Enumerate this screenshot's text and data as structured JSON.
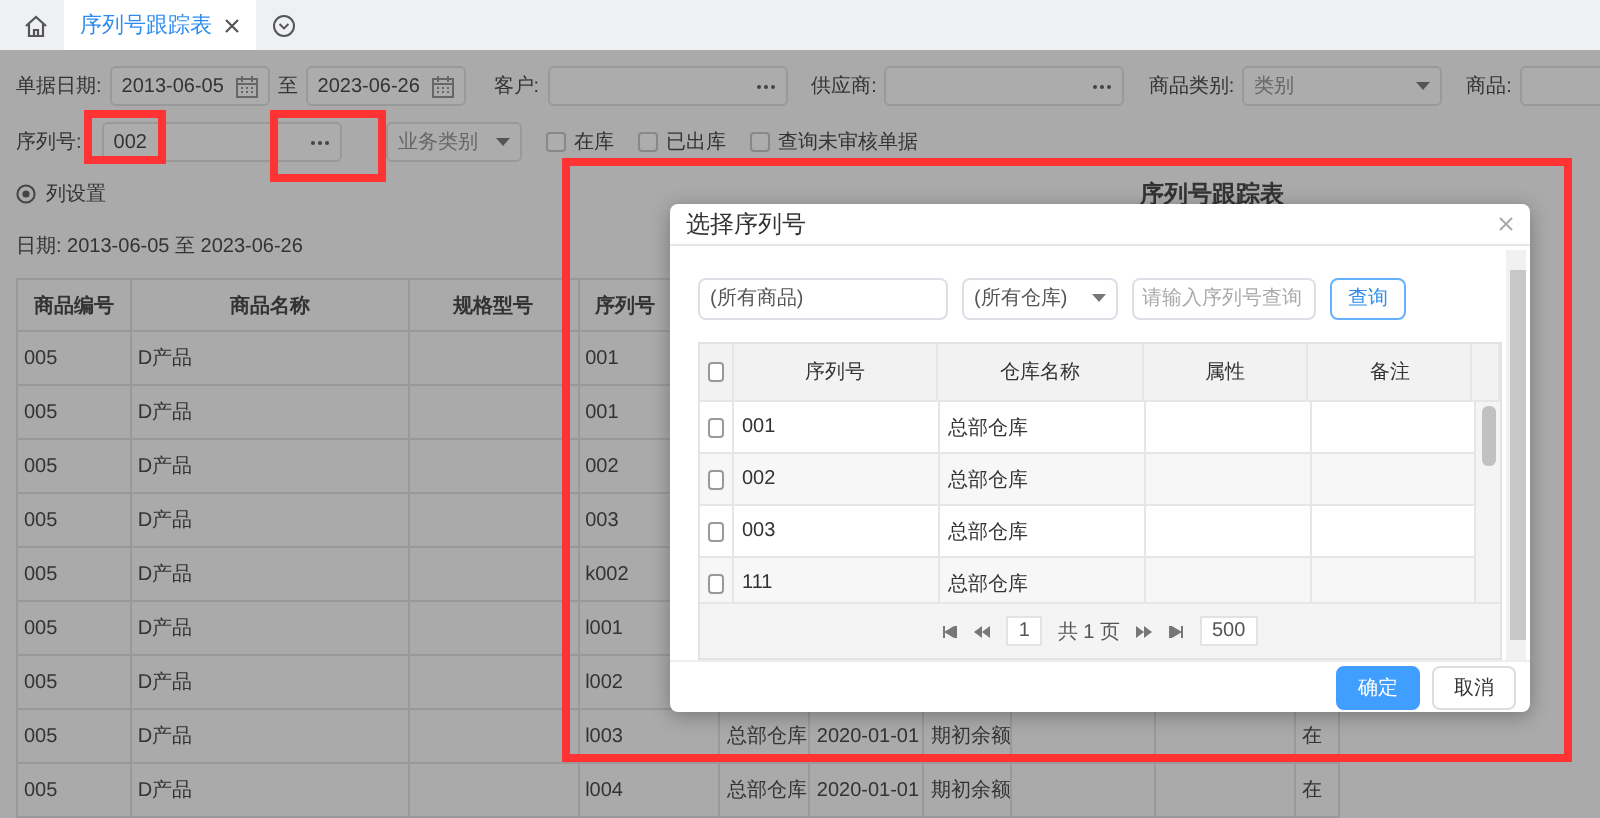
{
  "tab_bar": {
    "tabs": [
      {
        "label": "序列号跟踪表",
        "selected": true
      }
    ]
  },
  "filters": {
    "date_label": "单据日期:",
    "date_from": "2013-06-05",
    "date_to_label": "至",
    "date_to": "2023-06-26",
    "customer_label": "客户:",
    "supplier_label": "供应商:",
    "category_label": "商品类别:",
    "category_placeholder": "类别",
    "product_label": "商品:",
    "serial_label": "序列号:",
    "serial_value": "002",
    "business_type_placeholder": "业务类别",
    "checkboxes": [
      {
        "label": "在库",
        "checked": false
      },
      {
        "label": "已出库",
        "checked": false
      },
      {
        "label": "查询未审核单据",
        "checked": false
      }
    ]
  },
  "report": {
    "column_settings": "列设置",
    "title": "序列号跟踪表",
    "date_range": "日期: 2013-06-05 至 2023-06-26",
    "columns": [
      "商品编号",
      "商品名称",
      "规格型号",
      "序列号"
    ],
    "rows": [
      {
        "code": "005",
        "name": "D产品",
        "serial": "001"
      },
      {
        "code": "005",
        "name": "D产品",
        "serial": "001"
      },
      {
        "code": "005",
        "name": "D产品",
        "serial": "002"
      },
      {
        "code": "005",
        "name": "D产品",
        "serial": "003"
      },
      {
        "code": "005",
        "name": "D产品",
        "serial": "k002"
      },
      {
        "code": "005",
        "name": "D产品",
        "serial": "l001"
      },
      {
        "code": "005",
        "name": "D产品",
        "serial": "l002"
      },
      {
        "code": "005",
        "name": "D产品",
        "serial": "l003",
        "warehouse": "总部仓库",
        "date": "2020-01-01",
        "type": "期初余额",
        "status": "在"
      },
      {
        "code": "005",
        "name": "D产品",
        "serial": "l004",
        "warehouse": "总部仓库",
        "date": "2020-01-01",
        "type": "期初余额",
        "status": "在"
      }
    ]
  },
  "dialog": {
    "title": "选择序列号",
    "product_field": "(所有商品)",
    "warehouse_select": "(所有仓库)",
    "serial_search_placeholder": "请输入序列号查询",
    "query_button": "查询",
    "all_checked": false,
    "columns": [
      "序列号",
      "仓库名称",
      "属性",
      "备注"
    ],
    "rows": [
      {
        "serial": "001",
        "warehouse": "总部仓库",
        "checked": false
      },
      {
        "serial": "002",
        "warehouse": "总部仓库",
        "checked": false
      },
      {
        "serial": "003",
        "warehouse": "总部仓库",
        "checked": false
      },
      {
        "serial": "111",
        "warehouse": "总部仓库",
        "checked": false
      }
    ],
    "pager": {
      "page": "1",
      "total": "共 1 页",
      "page_size": "500"
    },
    "buttons": [
      {
        "label": "确定",
        "kind": "primary"
      },
      {
        "label": "取消",
        "kind": "default"
      }
    ]
  }
}
